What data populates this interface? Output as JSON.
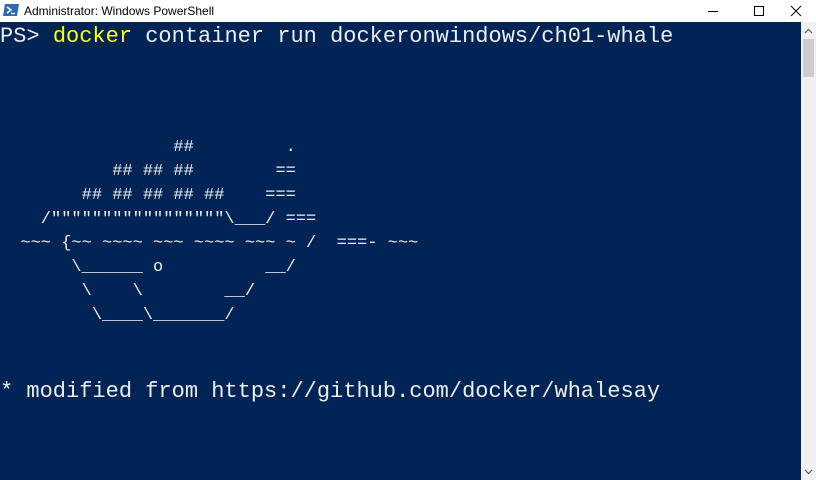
{
  "window": {
    "title": "Administrator: Windows PowerShell",
    "app_icon": "powershell-icon",
    "controls": {
      "minimize": "minimize-icon",
      "maximize": "maximize-icon",
      "close": "close-icon"
    }
  },
  "console": {
    "prompt": "PS> ",
    "command": "docker",
    "arguments": " container run dockeronwindows/ch01-whale",
    "art_lines": [
      "                 ##         .",
      "           ## ## ##        ==",
      "        ## ## ## ## ##    ===",
      "    /\"\"\"\"\"\"\"\"\"\"\"\"\"\"\"\"\"\\___/ ===",
      "  ~~~ {~~ ~~~~ ~~~ ~~~~ ~~~ ~ /  ===- ~~~",
      "       \\______ o          __/",
      "        \\    \\        __/",
      "         \\____\\_______/"
    ],
    "footer": "* modified from https://github.com/docker/whalesay",
    "colors": {
      "background": "#012456",
      "text": "#eeedf0",
      "keyword": "#ffff00"
    }
  },
  "scrollbar": {
    "up_icon": "scroll-up-icon",
    "down_icon": "scroll-down-icon"
  }
}
